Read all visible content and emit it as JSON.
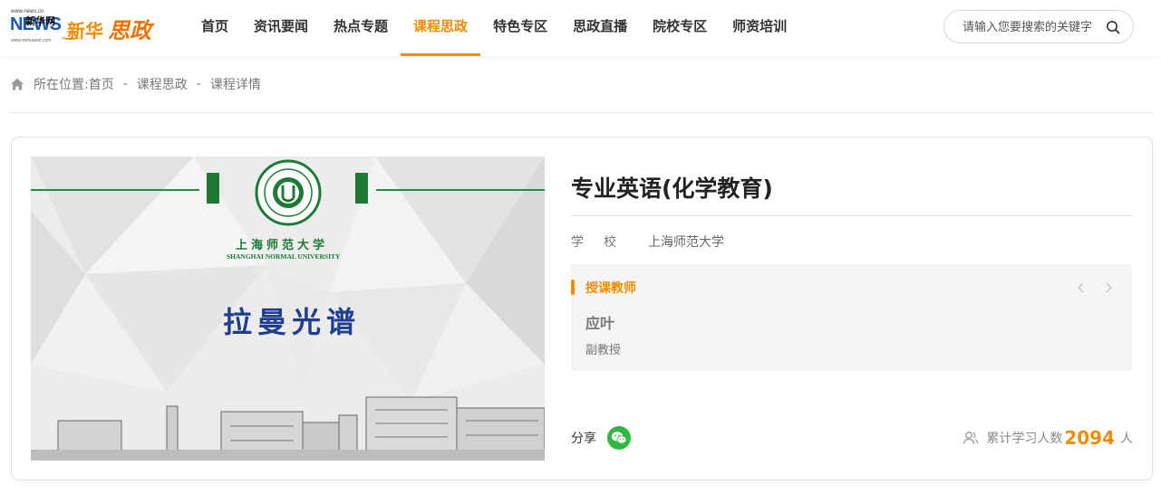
{
  "header": {
    "logo": {
      "news_small": "www.news.cn",
      "news_big": "NEWS",
      "news_cn": "新华网",
      "news_url": "www.xinhuanet.com",
      "brand_a": "新华",
      "brand_b": "思政"
    },
    "nav": [
      {
        "label": "首页",
        "active": false
      },
      {
        "label": "资讯要闻",
        "active": false
      },
      {
        "label": "热点专题",
        "active": false
      },
      {
        "label": "课程思政",
        "active": true
      },
      {
        "label": "特色专区",
        "active": false
      },
      {
        "label": "思政直播",
        "active": false
      },
      {
        "label": "院校专区",
        "active": false
      },
      {
        "label": "师资培训",
        "active": false
      }
    ],
    "search": {
      "placeholder": "请输入您要搜索的关键字",
      "icon": "search-icon"
    }
  },
  "breadcrumb": {
    "icon": "home-icon",
    "prefix": "所在位置:",
    "items": [
      "首页",
      "课程思政",
      "课程详情"
    ],
    "separator": "-"
  },
  "course": {
    "cover": {
      "university_cn": "上海师范大学",
      "university_en": "SHANGHAI NORMAL UNIVERSITY",
      "artwork_title": "拉曼光谱"
    },
    "title": "专业英语(化学教育)",
    "school_label": "学校",
    "school_value": "上海师范大学",
    "teacher_section": {
      "heading": "授课教师",
      "teacher_name": "应叶",
      "teacher_title": "副教授",
      "prev_icon": "chevron-left-icon",
      "next_icon": "chevron-right-icon"
    },
    "share_label": "分享",
    "share_icon": "wechat-icon",
    "learners": {
      "icon": "people-icon",
      "label": "累计学习人数",
      "count": "2094",
      "unit": "人"
    }
  },
  "colors": {
    "accent": "#f08c00",
    "university_green": "#1d7a36",
    "wechat_green": "#2fb940"
  }
}
